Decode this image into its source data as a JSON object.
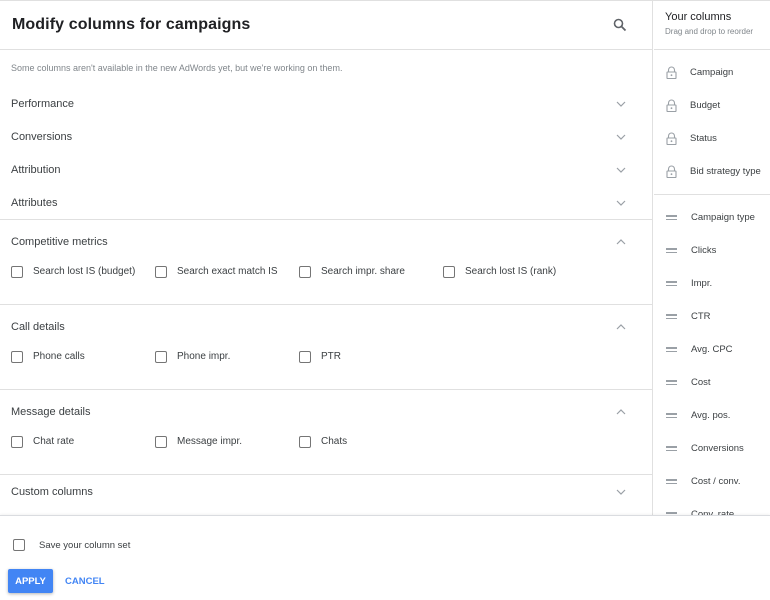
{
  "dialog": {
    "title": "Modify columns for campaigns",
    "notice": "Some columns aren't available in the new AdWords yet, but we're working on them."
  },
  "categories": [
    {
      "label": "Performance",
      "expanded": false
    },
    {
      "label": "Conversions",
      "expanded": false
    },
    {
      "label": "Attribution",
      "expanded": false
    },
    {
      "label": "Attributes",
      "expanded": false
    }
  ],
  "sections": {
    "competitive": {
      "label": "Competitive metrics",
      "items": [
        "Search lost IS (budget)",
        "Search exact match IS",
        "Search impr. share",
        "Search lost IS (rank)"
      ]
    },
    "call": {
      "label": "Call details",
      "items": [
        "Phone calls",
        "Phone impr.",
        "PTR"
      ]
    },
    "message": {
      "label": "Message details",
      "items": [
        "Chat rate",
        "Message impr.",
        "Chats"
      ]
    },
    "custom": {
      "label": "Custom columns"
    }
  },
  "your_columns": {
    "title": "Your columns",
    "subtitle": "Drag and drop to reorder",
    "locked": [
      "Campaign",
      "Budget",
      "Status",
      "Bid strategy type"
    ],
    "draggable": [
      "Campaign type",
      "Clicks",
      "Impr.",
      "CTR",
      "Avg. CPC",
      "Cost",
      "Avg. pos.",
      "Conversions",
      "Cost / conv.",
      "Conv. rate"
    ]
  },
  "footer": {
    "save_label": "Save your column set",
    "apply_label": "APPLY",
    "cancel_label": "CANCEL"
  },
  "icons": {
    "expand": "⌄",
    "collapse": "⌃"
  },
  "colors": {
    "accent": "#4285f4"
  }
}
